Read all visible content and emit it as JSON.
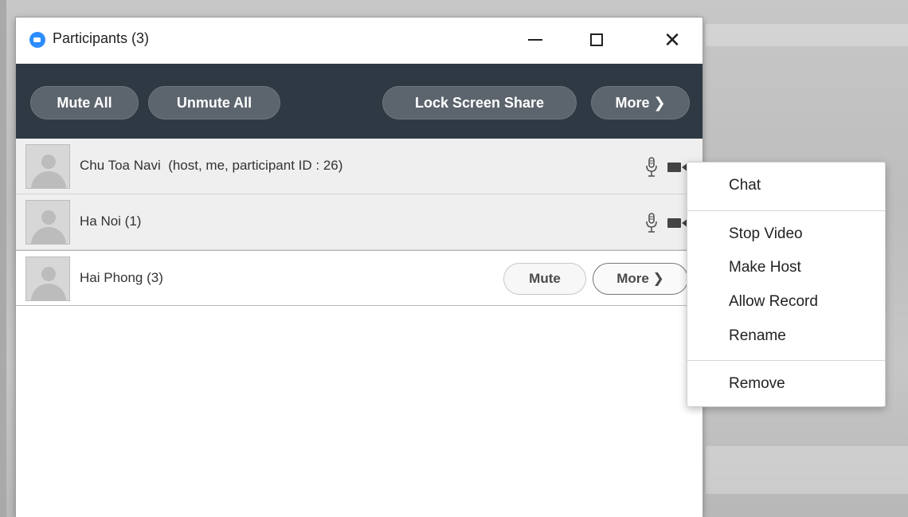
{
  "window": {
    "title": "Participants (3)"
  },
  "toolbar": {
    "mute_all": "Mute All",
    "unmute_all": "Unmute All",
    "lock_screen_share": "Lock Screen Share",
    "more": "More ❯"
  },
  "participants": [
    {
      "name": "Chu Toa Navi  (host, me, participant ID : 26)",
      "mic": "microphone-icon",
      "video": "video-camera-icon"
    },
    {
      "name": "Ha Noi (1)",
      "mic": "microphone-icon",
      "video": "video-camera-icon"
    },
    {
      "name": "Hai Phong (3)",
      "mute_label": "Mute",
      "more_label": "More ❯"
    }
  ],
  "context_menu": {
    "items": [
      "Chat",
      "Stop Video",
      "Make Host",
      "Allow Record",
      "Rename",
      "Remove"
    ]
  },
  "colors": {
    "toolbar_bg": "#2e3943",
    "pill_bg": "#5c656d",
    "zoom_blue": "#2d8cff"
  }
}
